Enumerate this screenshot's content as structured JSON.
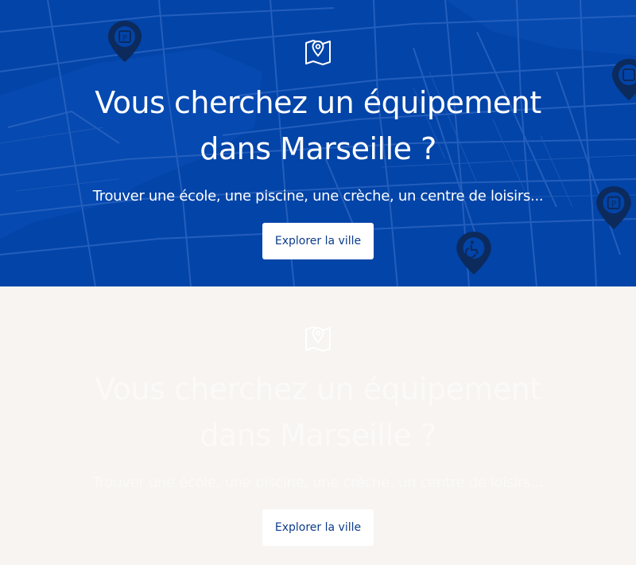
{
  "hero_primary": {
    "title": "Vous cherchez un équipement dans Marseille ?",
    "subtitle": "Trouver une école, une piscine, une crèche, un centre de loisirs...",
    "button_label": "Explorer la ville"
  },
  "hero_secondary": {
    "title": "Vous cherchez un équipement dans Marseille ?",
    "subtitle": "Trouver une école, une piscine, une crèche, un centre de loisirs...",
    "button_label": "Explorer la ville"
  },
  "colors": {
    "hero_blue": "#0244a8",
    "map_lines": "#2a63c0",
    "pin_dark": "#0c2a5c",
    "button_text": "#0b3b8c",
    "light_bg": "#f7f4f1"
  },
  "icons": {
    "hero_icon": "map-location-icon",
    "pins": [
      "parking-pin-icon",
      "building-pin-icon",
      "parking-pin-icon",
      "accessibility-pin-icon"
    ]
  }
}
